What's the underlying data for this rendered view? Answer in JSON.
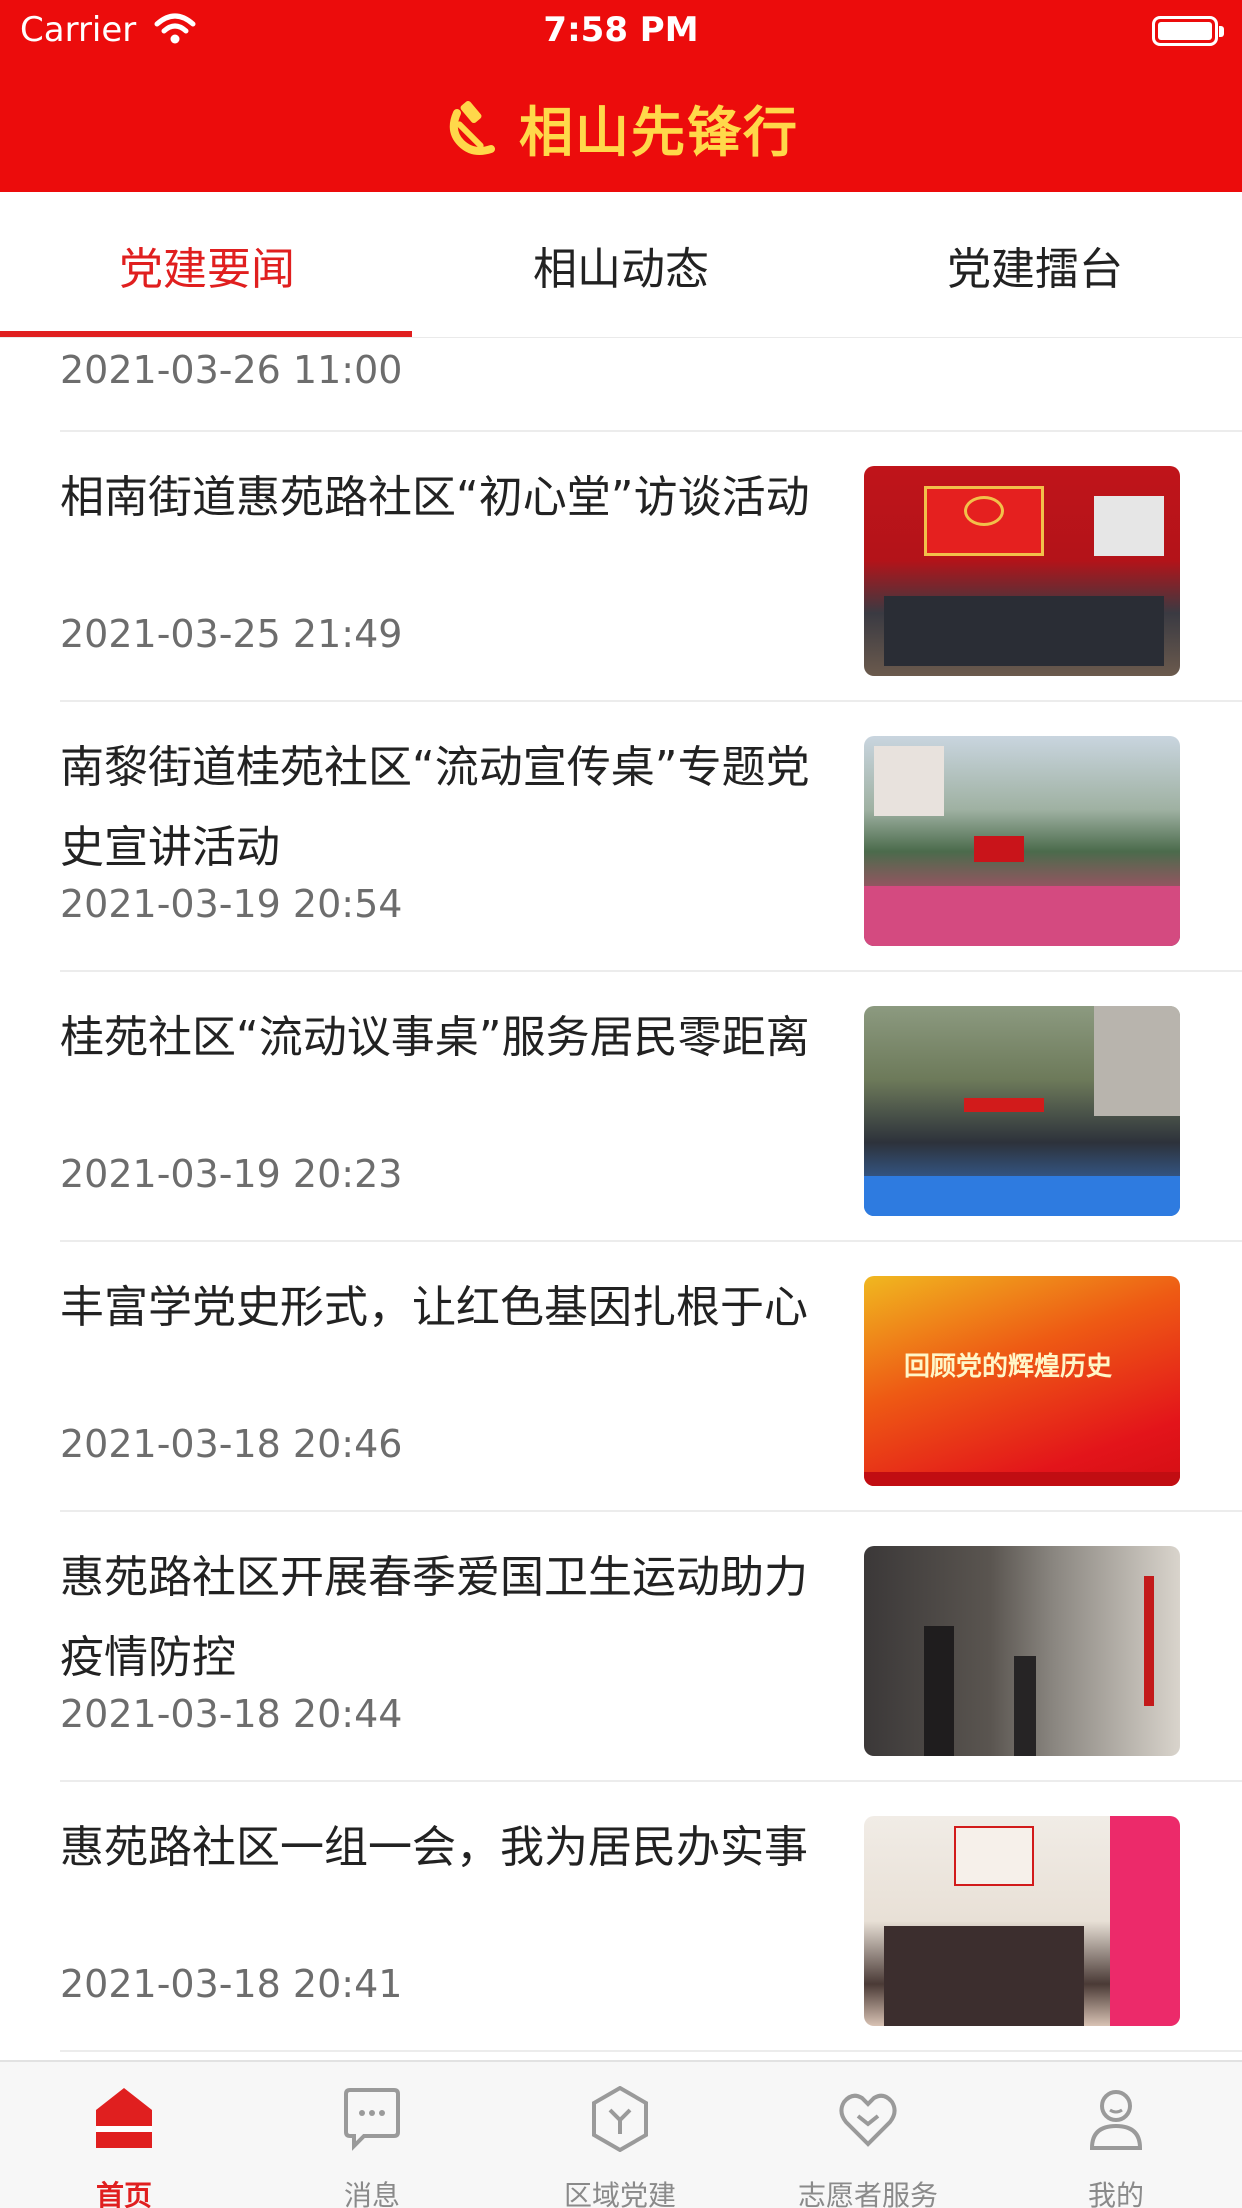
{
  "status_bar": {
    "carrier": "Carrier",
    "time": "7:58 PM"
  },
  "header": {
    "title": "相山先锋行",
    "accent": "#ec0c0c",
    "title_color": "#ffd84a"
  },
  "tabs": [
    {
      "label": "党建要闻",
      "active": true
    },
    {
      "label": "相山动态",
      "active": false
    },
    {
      "label": "党建擂台",
      "active": false
    }
  ],
  "news": [
    {
      "title": "",
      "date": "2021-03-26 11:00"
    },
    {
      "title": "相南街道惠苑路社区“初心堂”访谈活动",
      "date": "2021-03-25 21:49"
    },
    {
      "title": "南黎街道桂苑社区“流动宣传桌”专题党史宣讲活动",
      "date": "2021-03-19 20:54"
    },
    {
      "title": " 桂苑社区“流动议事桌”服务居民零距离",
      "date": "2021-03-19 20:23"
    },
    {
      "title": "丰富学党史形式，让红色基因扎根于心",
      "date": "2021-03-18 20:46"
    },
    {
      "title": "惠苑路社区开展春季爱国卫生运动助力疫情防控",
      "date": "2021-03-18 20:44"
    },
    {
      "title": "惠苑路社区一组一会，我为居民办实事",
      "date": "2021-03-18 20:41"
    }
  ],
  "thumb_banner": {
    "headline": "回顾党的辉煌历史"
  },
  "tabbar": [
    {
      "label": "首页",
      "icon": "home-icon",
      "active": true
    },
    {
      "label": "消息",
      "icon": "message-icon",
      "active": false
    },
    {
      "label": "区域党建",
      "icon": "region-party-icon",
      "active": false
    },
    {
      "label": "志愿者服务",
      "icon": "volunteer-heart-icon",
      "active": false
    },
    {
      "label": "我的",
      "icon": "profile-icon",
      "active": false
    }
  ]
}
